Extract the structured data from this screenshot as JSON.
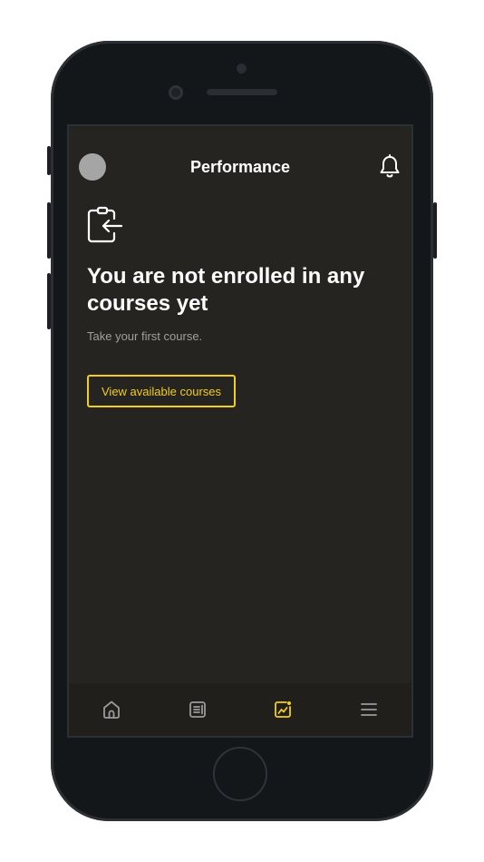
{
  "header": {
    "title": "Performance",
    "avatar_color": "#a5a5a5",
    "notification_icon": "bell-icon"
  },
  "empty_state": {
    "icon": "clipboard-return-icon",
    "headline": "You are not enrolled in any courses yet",
    "subtext": "Take your first course.",
    "cta_label": "View available courses"
  },
  "bottom_nav": {
    "items": [
      {
        "icon": "home-icon",
        "active": false
      },
      {
        "icon": "document-icon",
        "active": false
      },
      {
        "icon": "performance-chart-icon",
        "active": true
      },
      {
        "icon": "menu-icon",
        "active": false
      }
    ]
  },
  "colors": {
    "background": "#252420",
    "accent": "#f2cd22",
    "text": "#ffffff",
    "muted_text": "#a29f98",
    "nav_background": "#201f1c",
    "nav_icon": "#9b9b9b"
  }
}
